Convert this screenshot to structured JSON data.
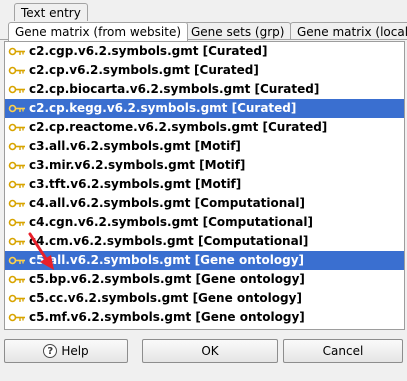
{
  "tabs": {
    "text_entry": "Text entry",
    "gene_matrix_website": "Gene matrix (from website)",
    "gene_sets_grp": "Gene sets (grp)",
    "gene_matrix_local": "Gene matrix (local g"
  },
  "list": {
    "items": [
      {
        "label": "c2.cgp.v6.2.symbols.gmt [Curated]",
        "selected": false
      },
      {
        "label": "c2.cp.v6.2.symbols.gmt [Curated]",
        "selected": false
      },
      {
        "label": "c2.cp.biocarta.v6.2.symbols.gmt [Curated]",
        "selected": false
      },
      {
        "label": "c2.cp.kegg.v6.2.symbols.gmt [Curated]",
        "selected": true
      },
      {
        "label": "c2.cp.reactome.v6.2.symbols.gmt [Curated]",
        "selected": false
      },
      {
        "label": "c3.all.v6.2.symbols.gmt [Motif]",
        "selected": false
      },
      {
        "label": "c3.mir.v6.2.symbols.gmt [Motif]",
        "selected": false
      },
      {
        "label": "c3.tft.v6.2.symbols.gmt [Motif]",
        "selected": false
      },
      {
        "label": "c4.all.v6.2.symbols.gmt [Computational]",
        "selected": false
      },
      {
        "label": "c4.cgn.v6.2.symbols.gmt [Computational]",
        "selected": false
      },
      {
        "label": "c4.cm.v6.2.symbols.gmt [Computational]",
        "selected": false
      },
      {
        "label": "c5.all.v6.2.symbols.gmt [Gene ontology]",
        "selected": true
      },
      {
        "label": "c5.bp.v6.2.symbols.gmt [Gene ontology]",
        "selected": false
      },
      {
        "label": "c5.cc.v6.2.symbols.gmt [Gene ontology]",
        "selected": false
      },
      {
        "label": "c5.mf.v6.2.symbols.gmt [Gene ontology]",
        "selected": false
      }
    ]
  },
  "buttons": {
    "help": "Help",
    "help_icon_glyph": "?",
    "ok": "OK",
    "cancel": "Cancel"
  },
  "colors": {
    "selection": "#3a6fd0",
    "annotation_arrow": "#e8202a"
  }
}
